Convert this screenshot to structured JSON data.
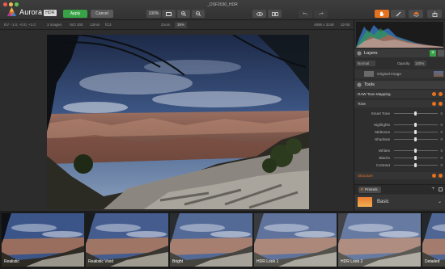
{
  "window": {
    "title": "_DSF2030_HDR"
  },
  "app": {
    "name": "Aurora",
    "badge": "HDR"
  },
  "toolbar": {
    "apply_label": "Apply",
    "cancel_label": "Cancel",
    "zoom_value": "100%"
  },
  "infobar": {
    "ev_label": "EV: -1.0, +0.0, +1.0",
    "images": "3 images",
    "iso": "ISO 200",
    "focal": "13mm",
    "aperture": "f/13",
    "zoom_label": "Zoom",
    "zoom_value": "35%",
    "dimensions": "4896 x 3248",
    "bits": "32-bit"
  },
  "layers": {
    "title": "Layers",
    "blend_mode": "Normal",
    "opacity_label": "Opacity",
    "opacity_value": "100%",
    "item_label": "Original Image"
  },
  "tools": {
    "title": "Tools",
    "raw_label": "RAW Tone Mapping",
    "tone_label": "Tone",
    "smart_tone_label": "Smart Tone",
    "highlights_label": "Highlights",
    "midtones_label": "Midtones",
    "shadows_label": "Shadows",
    "whites_label": "Whites",
    "blacks_label": "Blacks",
    "contrast_label": "Contrast",
    "structure_label": "Structure",
    "zero": "0"
  },
  "presets": {
    "button_label": "Presets",
    "current": "Basic"
  },
  "filmstrip": [
    {
      "label": "Realistic"
    },
    {
      "label": "Realistic Vivid"
    },
    {
      "label": "Bright"
    },
    {
      "label": "HDR Look 1"
    },
    {
      "label": "HDR Look 2"
    },
    {
      "label": "Detailed"
    }
  ],
  "colors": {
    "accent_orange": "#e5721f",
    "apply_green": "#37a246",
    "panel_bg": "#2e2e2e"
  }
}
